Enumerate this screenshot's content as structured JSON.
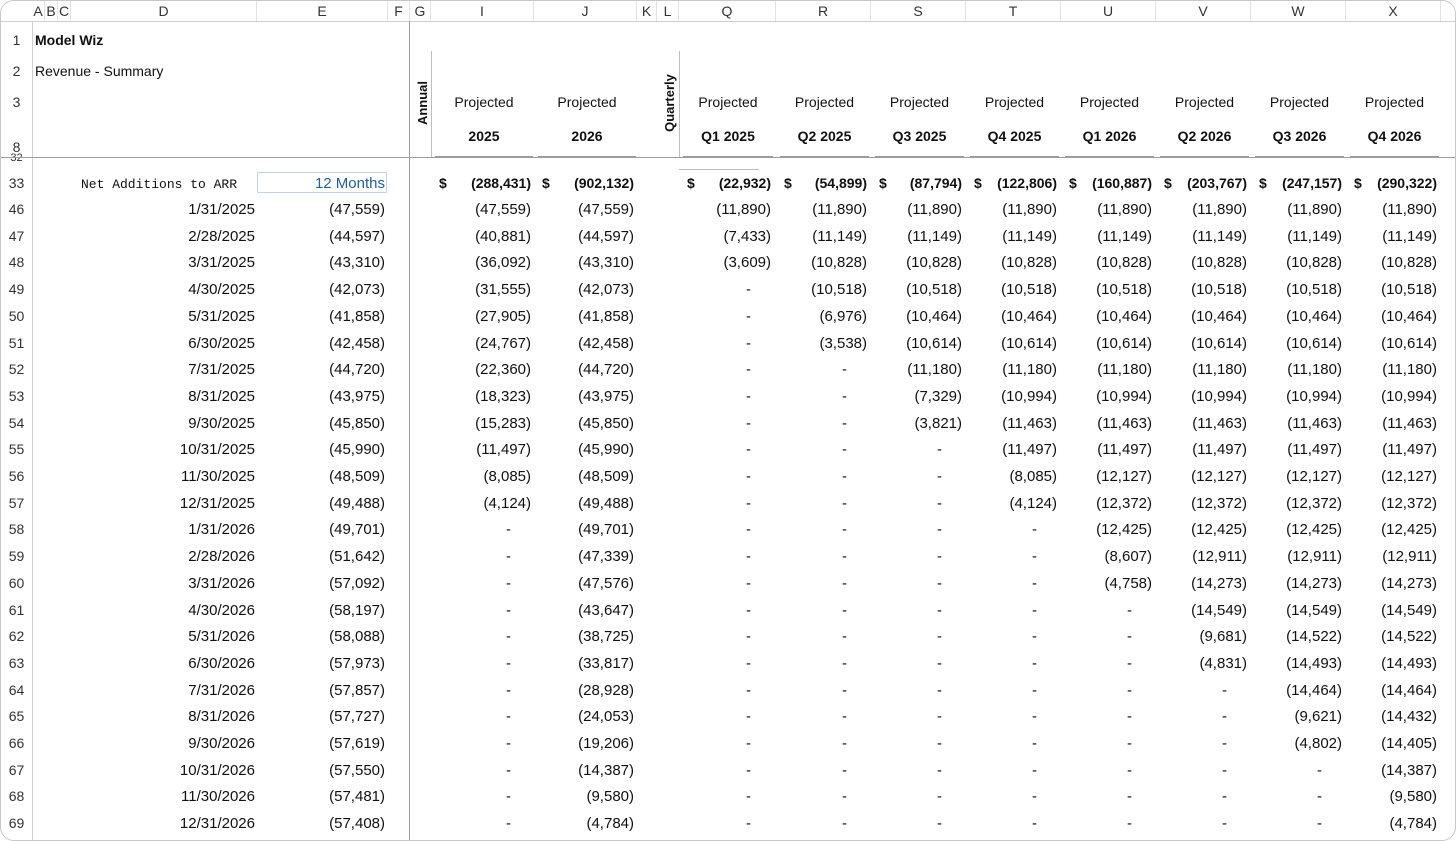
{
  "columns": [
    "A",
    "B",
    "C",
    "D",
    "E",
    "F",
    "G",
    "I",
    "J",
    "K",
    "L",
    "Q",
    "R",
    "S",
    "T",
    "U",
    "V",
    "W",
    "X"
  ],
  "title": "Model Wiz",
  "subtitle": "Revenue - Summary",
  "annual_label": "Annual",
  "quarterly_label": "Quarterly",
  "period_headers": [
    {
      "top": "Projected",
      "bottom": "2025"
    },
    {
      "top": "Projected",
      "bottom": "2026"
    },
    {
      "top": "Projected",
      "bottom": "Q1 2025"
    },
    {
      "top": "Projected",
      "bottom": "Q2 2025"
    },
    {
      "top": "Projected",
      "bottom": "Q3 2025"
    },
    {
      "top": "Projected",
      "bottom": "Q4 2025"
    },
    {
      "top": "Projected",
      "bottom": "Q1 2026"
    },
    {
      "top": "Projected",
      "bottom": "Q2 2026"
    },
    {
      "top": "Projected",
      "bottom": "Q3 2026"
    },
    {
      "top": "Projected",
      "bottom": "Q4 2026"
    }
  ],
  "header_rows": [
    "1",
    "2",
    "3",
    "8",
    "32"
  ],
  "summary_row": {
    "row_num": "33",
    "label": "Net Additions to ARR",
    "input_value": "12 Months",
    "currency": "$",
    "values": [
      "(288,431)",
      "(902,132)",
      "(22,932)",
      "(54,899)",
      "(87,794)",
      "(122,806)",
      "(160,887)",
      "(203,767)",
      "(247,157)",
      "(290,322)"
    ]
  },
  "rows": [
    {
      "n": "46",
      "date": "1/31/2025",
      "e": "(47,559)",
      "v": [
        "(47,559)",
        "(47,559)",
        "(11,890)",
        "(11,890)",
        "(11,890)",
        "(11,890)",
        "(11,890)",
        "(11,890)",
        "(11,890)",
        "(11,890)"
      ]
    },
    {
      "n": "47",
      "date": "2/28/2025",
      "e": "(44,597)",
      "v": [
        "(40,881)",
        "(44,597)",
        "(7,433)",
        "(11,149)",
        "(11,149)",
        "(11,149)",
        "(11,149)",
        "(11,149)",
        "(11,149)",
        "(11,149)"
      ]
    },
    {
      "n": "48",
      "date": "3/31/2025",
      "e": "(43,310)",
      "v": [
        "(36,092)",
        "(43,310)",
        "(3,609)",
        "(10,828)",
        "(10,828)",
        "(10,828)",
        "(10,828)",
        "(10,828)",
        "(10,828)",
        "(10,828)"
      ]
    },
    {
      "n": "49",
      "date": "4/30/2025",
      "e": "(42,073)",
      "v": [
        "(31,555)",
        "(42,073)",
        "-",
        "(10,518)",
        "(10,518)",
        "(10,518)",
        "(10,518)",
        "(10,518)",
        "(10,518)",
        "(10,518)"
      ]
    },
    {
      "n": "50",
      "date": "5/31/2025",
      "e": "(41,858)",
      "v": [
        "(27,905)",
        "(41,858)",
        "-",
        "(6,976)",
        "(10,464)",
        "(10,464)",
        "(10,464)",
        "(10,464)",
        "(10,464)",
        "(10,464)"
      ]
    },
    {
      "n": "51",
      "date": "6/30/2025",
      "e": "(42,458)",
      "v": [
        "(24,767)",
        "(42,458)",
        "-",
        "(3,538)",
        "(10,614)",
        "(10,614)",
        "(10,614)",
        "(10,614)",
        "(10,614)",
        "(10,614)"
      ]
    },
    {
      "n": "52",
      "date": "7/31/2025",
      "e": "(44,720)",
      "v": [
        "(22,360)",
        "(44,720)",
        "-",
        "-",
        "(11,180)",
        "(11,180)",
        "(11,180)",
        "(11,180)",
        "(11,180)",
        "(11,180)"
      ]
    },
    {
      "n": "53",
      "date": "8/31/2025",
      "e": "(43,975)",
      "v": [
        "(18,323)",
        "(43,975)",
        "-",
        "-",
        "(7,329)",
        "(10,994)",
        "(10,994)",
        "(10,994)",
        "(10,994)",
        "(10,994)"
      ]
    },
    {
      "n": "54",
      "date": "9/30/2025",
      "e": "(45,850)",
      "v": [
        "(15,283)",
        "(45,850)",
        "-",
        "-",
        "(3,821)",
        "(11,463)",
        "(11,463)",
        "(11,463)",
        "(11,463)",
        "(11,463)"
      ]
    },
    {
      "n": "55",
      "date": "10/31/2025",
      "e": "(45,990)",
      "v": [
        "(11,497)",
        "(45,990)",
        "-",
        "-",
        "-",
        "(11,497)",
        "(11,497)",
        "(11,497)",
        "(11,497)",
        "(11,497)"
      ]
    },
    {
      "n": "56",
      "date": "11/30/2025",
      "e": "(48,509)",
      "v": [
        "(8,085)",
        "(48,509)",
        "-",
        "-",
        "-",
        "(8,085)",
        "(12,127)",
        "(12,127)",
        "(12,127)",
        "(12,127)"
      ]
    },
    {
      "n": "57",
      "date": "12/31/2025",
      "e": "(49,488)",
      "v": [
        "(4,124)",
        "(49,488)",
        "-",
        "-",
        "-",
        "(4,124)",
        "(12,372)",
        "(12,372)",
        "(12,372)",
        "(12,372)"
      ]
    },
    {
      "n": "58",
      "date": "1/31/2026",
      "e": "(49,701)",
      "v": [
        "-",
        "(49,701)",
        "-",
        "-",
        "-",
        "-",
        "(12,425)",
        "(12,425)",
        "(12,425)",
        "(12,425)"
      ]
    },
    {
      "n": "59",
      "date": "2/28/2026",
      "e": "(51,642)",
      "v": [
        "-",
        "(47,339)",
        "-",
        "-",
        "-",
        "-",
        "(8,607)",
        "(12,911)",
        "(12,911)",
        "(12,911)"
      ]
    },
    {
      "n": "60",
      "date": "3/31/2026",
      "e": "(57,092)",
      "v": [
        "-",
        "(47,576)",
        "-",
        "-",
        "-",
        "-",
        "(4,758)",
        "(14,273)",
        "(14,273)",
        "(14,273)"
      ]
    },
    {
      "n": "61",
      "date": "4/30/2026",
      "e": "(58,197)",
      "v": [
        "-",
        "(43,647)",
        "-",
        "-",
        "-",
        "-",
        "-",
        "(14,549)",
        "(14,549)",
        "(14,549)"
      ]
    },
    {
      "n": "62",
      "date": "5/31/2026",
      "e": "(58,088)",
      "v": [
        "-",
        "(38,725)",
        "-",
        "-",
        "-",
        "-",
        "-",
        "(9,681)",
        "(14,522)",
        "(14,522)"
      ]
    },
    {
      "n": "63",
      "date": "6/30/2026",
      "e": "(57,973)",
      "v": [
        "-",
        "(33,817)",
        "-",
        "-",
        "-",
        "-",
        "-",
        "(4,831)",
        "(14,493)",
        "(14,493)"
      ]
    },
    {
      "n": "64",
      "date": "7/31/2026",
      "e": "(57,857)",
      "v": [
        "-",
        "(28,928)",
        "-",
        "-",
        "-",
        "-",
        "-",
        "-",
        "(14,464)",
        "(14,464)"
      ]
    },
    {
      "n": "65",
      "date": "8/31/2026",
      "e": "(57,727)",
      "v": [
        "-",
        "(24,053)",
        "-",
        "-",
        "-",
        "-",
        "-",
        "-",
        "(9,621)",
        "(14,432)"
      ]
    },
    {
      "n": "66",
      "date": "9/30/2026",
      "e": "(57,619)",
      "v": [
        "-",
        "(19,206)",
        "-",
        "-",
        "-",
        "-",
        "-",
        "-",
        "(4,802)",
        "(14,405)"
      ]
    },
    {
      "n": "67",
      "date": "10/31/2026",
      "e": "(57,550)",
      "v": [
        "-",
        "(14,387)",
        "-",
        "-",
        "-",
        "-",
        "-",
        "-",
        "-",
        "(14,387)"
      ]
    },
    {
      "n": "68",
      "date": "11/30/2026",
      "e": "(57,481)",
      "v": [
        "-",
        "(9,580)",
        "-",
        "-",
        "-",
        "-",
        "-",
        "-",
        "-",
        "(9,580)"
      ]
    },
    {
      "n": "69",
      "date": "12/31/2026",
      "e": "(57,408)",
      "v": [
        "-",
        "(4,784)",
        "-",
        "-",
        "-",
        "-",
        "-",
        "-",
        "-",
        "(4,784)"
      ]
    }
  ],
  "colors": {
    "input_text": "#1f5fa8",
    "grid": "#cfcfcf",
    "freeze": "#9e9e9e"
  }
}
